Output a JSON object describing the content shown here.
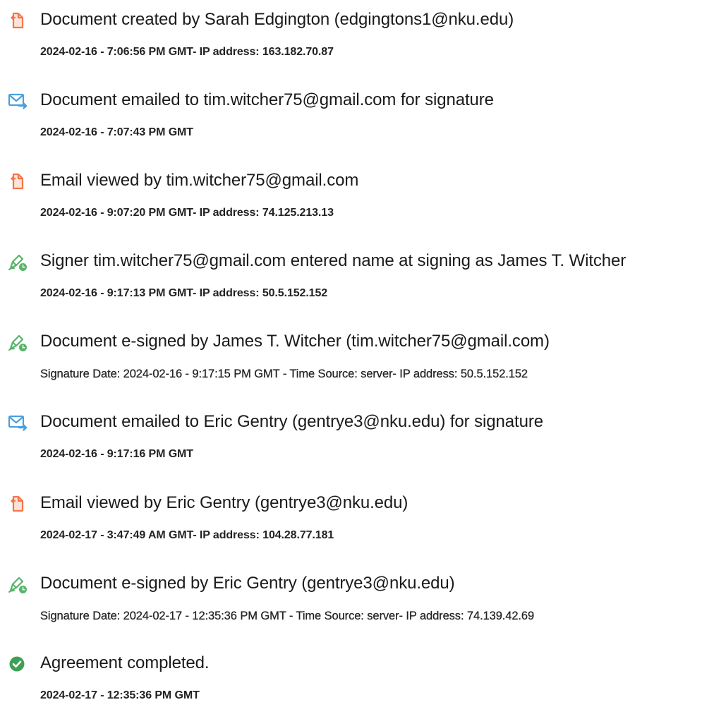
{
  "colors": {
    "doc_icon": "#f4754a",
    "mail_icon": "#4a9fde",
    "sign_icon": "#58b36a",
    "complete_icon": "#3ea055",
    "text": "#1a1a1a"
  },
  "events": [
    {
      "icon": "document-icon",
      "title": "Document created by Sarah Edgington (edgingtons1@nku.edu)",
      "meta": "2024-02-16 - 7:06:56 PM GMT- IP address: 163.182.70.87"
    },
    {
      "icon": "email-icon",
      "title": "Document emailed to tim.witcher75@gmail.com for signature",
      "meta": "2024-02-16 - 7:07:43 PM GMT"
    },
    {
      "icon": "document-icon",
      "title": "Email viewed by tim.witcher75@gmail.com",
      "meta": "2024-02-16 - 9:07:20 PM GMT- IP address: 74.125.213.13"
    },
    {
      "icon": "signature-icon",
      "title": "Signer tim.witcher75@gmail.com entered name at signing as James T. Witcher",
      "meta": "2024-02-16 - 9:17:13 PM GMT- IP address: 50.5.152.152"
    },
    {
      "icon": "signature-icon",
      "title": "Document e-signed by James T. Witcher (tim.witcher75@gmail.com)",
      "meta": "Signature Date: 2024-02-16 - 9:17:15 PM GMT - Time Source: server- IP address: 50.5.152.152"
    },
    {
      "icon": "email-icon",
      "title": "Document emailed to Eric Gentry (gentrye3@nku.edu) for signature",
      "meta": "2024-02-16 - 9:17:16 PM GMT"
    },
    {
      "icon": "document-icon",
      "title": "Email viewed by Eric Gentry (gentrye3@nku.edu)",
      "meta": "2024-02-17 - 3:47:49 AM GMT- IP address: 104.28.77.181"
    },
    {
      "icon": "signature-icon",
      "title": "Document e-signed by Eric Gentry (gentrye3@nku.edu)",
      "meta": "Signature Date: 2024-02-17 - 12:35:36 PM GMT - Time Source: server- IP address: 74.139.42.69"
    },
    {
      "icon": "checkmark-icon",
      "title": "Agreement completed.",
      "meta": "2024-02-17 - 12:35:36 PM GMT"
    }
  ]
}
